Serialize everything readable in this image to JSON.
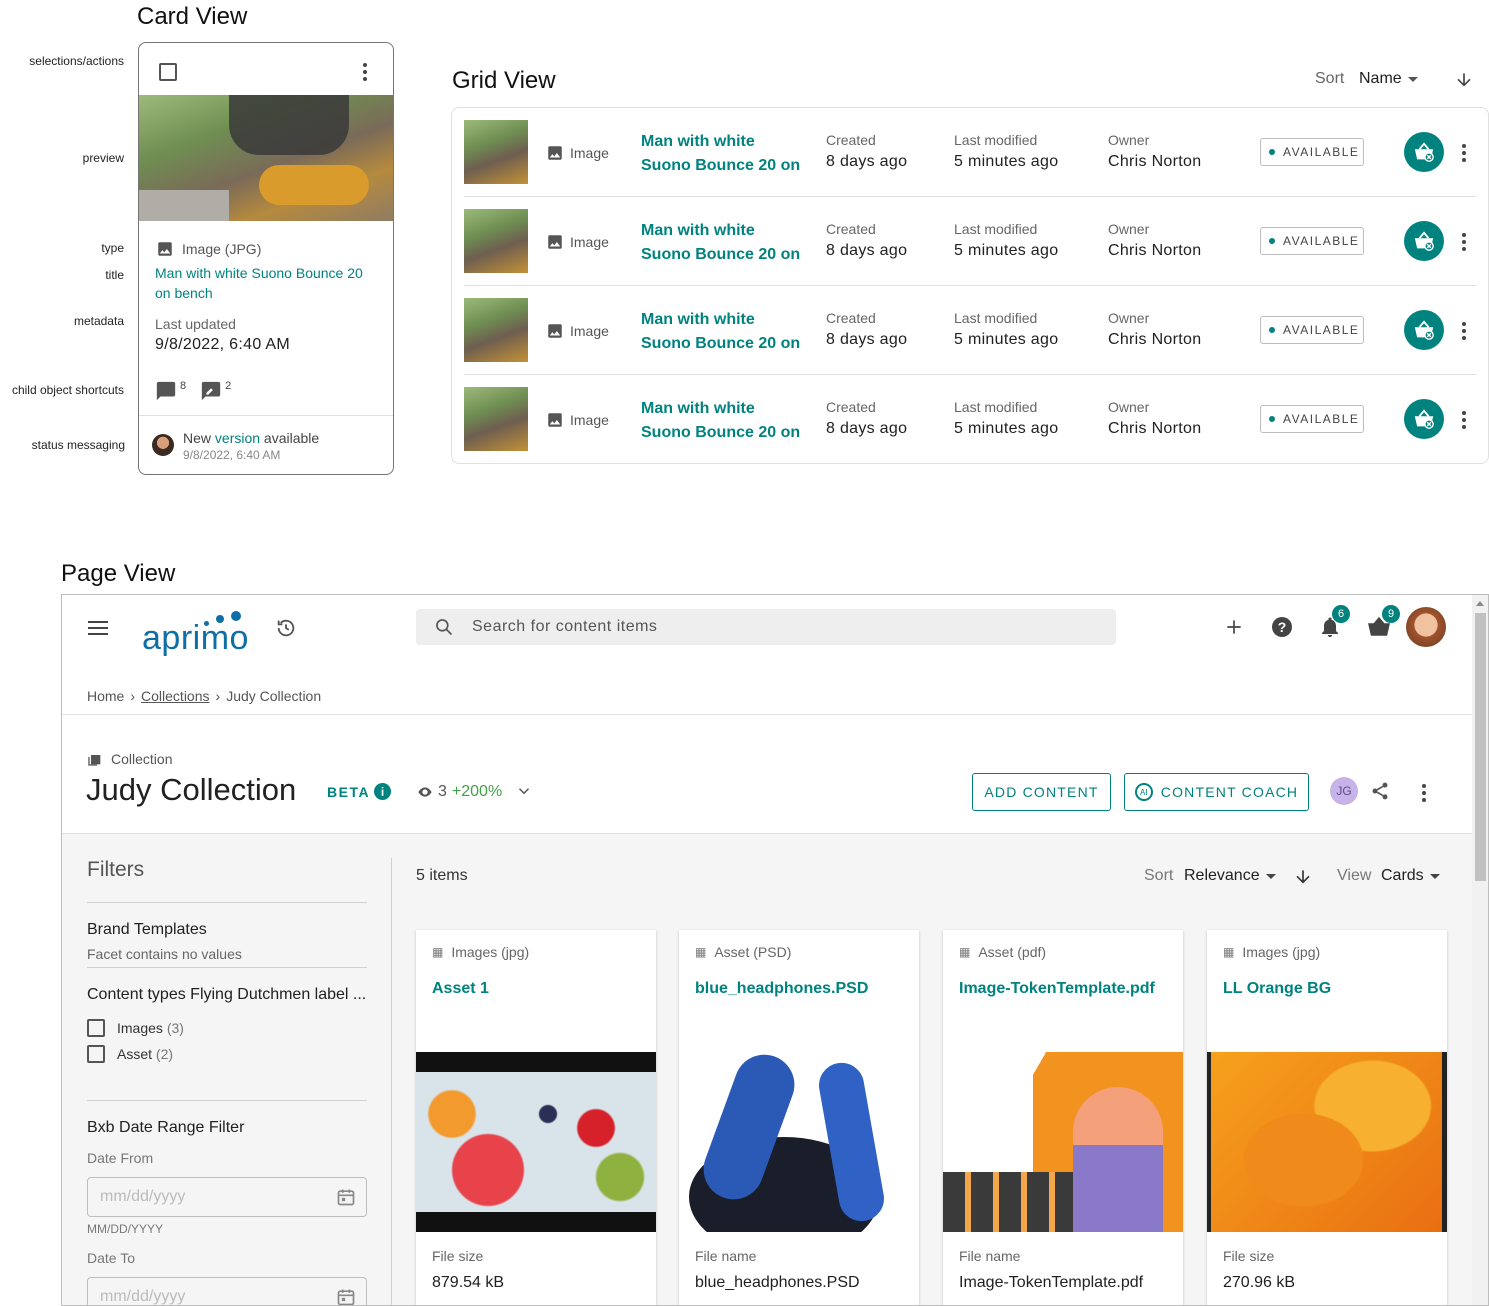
{
  "card_view": {
    "section_title": "Card View",
    "annotations": [
      "selections/actions",
      "preview",
      "type",
      "title",
      "metadata",
      "child object shortcuts",
      "status messaging"
    ],
    "type_label": "Image (JPG)",
    "title": "Man with white Suono Bounce 20 on bench",
    "meta_label": "Last updated",
    "meta_value": "9/8/2022, 6:40 AM",
    "comments_count": "8",
    "annotations_count": "2",
    "status_prefix": "New ",
    "status_link": "version",
    "status_suffix": " available",
    "status_time": "9/8/2022, 6:40 AM"
  },
  "grid_view": {
    "section_title": "Grid View",
    "sort_label": "Sort",
    "sort_value": "Name",
    "rows": [
      {
        "type": "Image",
        "title_line1": "Man with white",
        "title_line2": "Suono Bounce 20 on",
        "created_label": "Created",
        "created_value": "8 days ago",
        "modified_label": "Last modified",
        "modified_value": "5 minutes ago",
        "owner_label": "Owner",
        "owner_value": "Chris Norton",
        "status": "AVAILABLE"
      },
      {
        "type": "Image",
        "title_line1": "Man with white",
        "title_line2": "Suono Bounce 20 on",
        "created_label": "Created",
        "created_value": "8 days ago",
        "modified_label": "Last modified",
        "modified_value": "5 minutes ago",
        "owner_label": "Owner",
        "owner_value": "Chris Norton",
        "status": "AVAILABLE"
      },
      {
        "type": "Image",
        "title_line1": "Man with white",
        "title_line2": "Suono Bounce 20 on",
        "created_label": "Created",
        "created_value": "8 days ago",
        "modified_label": "Last modified",
        "modified_value": "5 minutes ago",
        "owner_label": "Owner",
        "owner_value": "Chris Norton",
        "status": "AVAILABLE"
      },
      {
        "type": "Image",
        "title_line1": "Man with white",
        "title_line2": "Suono Bounce 20 on",
        "created_label": "Created",
        "created_value": "8 days ago",
        "modified_label": "Last modified",
        "modified_value": "5 minutes ago",
        "owner_label": "Owner",
        "owner_value": "Chris Norton",
        "status": "AVAILABLE"
      }
    ]
  },
  "page_view": {
    "section_title": "Page View",
    "logo_text": "aprimo",
    "search_placeholder": "Search for content items",
    "notifications_count": "6",
    "cart_count": "9",
    "breadcrumb": [
      "Home",
      "Collections",
      "Judy Collection"
    ],
    "object_type": "Collection",
    "title": "Judy Collection",
    "beta_label": "BETA",
    "views_count": "3",
    "views_change": "+200%",
    "add_content_label": "ADD CONTENT",
    "content_coach_label": "CONTENT COACH",
    "user_initials": "JG",
    "filters": {
      "heading": "Filters",
      "brand_title": "Brand Templates",
      "brand_empty": "Facet contains no values",
      "content_types_title": "Content types Flying Dutchmen label ...",
      "options": [
        {
          "label": "Images",
          "count": "(3)"
        },
        {
          "label": "Asset",
          "count": "(2)"
        }
      ],
      "date_title": "Bxb Date Range Filter",
      "date_from_label": "Date From",
      "date_placeholder": "mm/dd/yyyy",
      "date_hint": "MM/DD/YYYY",
      "date_to_label": "Date To"
    },
    "results": {
      "count_label": "5 items",
      "sort_label": "Sort",
      "sort_value": "Relevance",
      "view_label": "View",
      "view_value": "Cards",
      "cards": [
        {
          "type": "Images (jpg)",
          "title": "Asset 1",
          "meta_label": "File size",
          "meta_value": "879.54 kB"
        },
        {
          "type": "Asset (PSD)",
          "title": "blue_headphones.PSD",
          "meta_label": "File name",
          "meta_value": "blue_headphones.PSD"
        },
        {
          "type": "Asset (pdf)",
          "title": "Image-TokenTemplate.pdf",
          "meta_label": "File name",
          "meta_value": "Image-TokenTemplate.pdf"
        },
        {
          "type": "Images (jpg)",
          "title": "LL Orange BG",
          "meta_label": "File size",
          "meta_value": "270.96 kB"
        }
      ]
    },
    "colors": {
      "accent": "#00827f",
      "change_positive": "#43a047",
      "page_bg": "#f5f5f5"
    }
  }
}
